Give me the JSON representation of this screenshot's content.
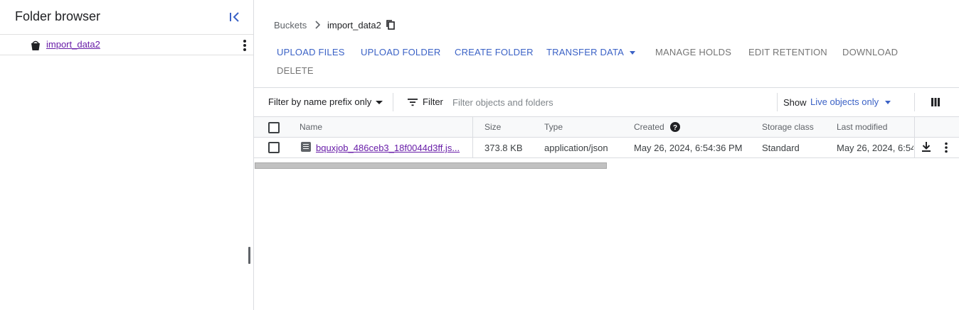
{
  "sidebar": {
    "title": "Folder browser",
    "items": [
      {
        "label": "import_data2",
        "icon": "bucket-icon"
      }
    ]
  },
  "breadcrumb": {
    "root": "Buckets",
    "current": "import_data2"
  },
  "toolbar": {
    "upload_files": "UPLOAD FILES",
    "upload_folder": "UPLOAD FOLDER",
    "create_folder": "CREATE FOLDER",
    "transfer_data": "TRANSFER DATA",
    "manage_holds": "MANAGE HOLDS",
    "edit_retention": "EDIT RETENTION",
    "download": "DOWNLOAD",
    "delete": "DELETE"
  },
  "filter": {
    "prefix_mode": "Filter by name prefix only",
    "label": "Filter",
    "placeholder": "Filter objects and folders",
    "show_label": "Show",
    "show_value": "Live objects only"
  },
  "table": {
    "columns": [
      "Name",
      "Size",
      "Type",
      "Created",
      "Storage class",
      "Last modified"
    ],
    "rows": [
      {
        "name": "bquxjob_486ceb3_18f0044d3ff.js...",
        "size": "373.8 KB",
        "type": "application/json",
        "created": "May 26, 2024, 6:54:36 PM",
        "storage_class": "Standard",
        "last_modified": "May 26, 2024, 6:54"
      }
    ]
  },
  "colors": {
    "accent": "#3b62c6",
    "link_visited": "#681da8",
    "disabled": "#757575"
  }
}
